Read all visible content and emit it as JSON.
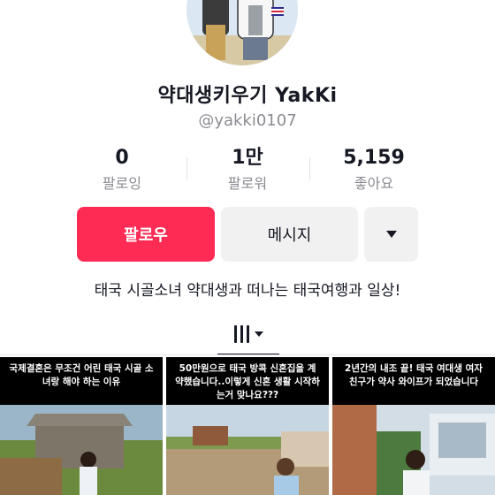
{
  "profile": {
    "display_name": "약대생키우기 YakKi",
    "username": "@yakki0107",
    "bio": "태국 시골소녀 약대생과 떠나는 태국여행과 일상!"
  },
  "stats": [
    {
      "value": "0",
      "label": "팔로잉"
    },
    {
      "value": "1만",
      "label": "팔로워"
    },
    {
      "value": "5,159",
      "label": "좋아요"
    }
  ],
  "actions": {
    "follow_label": "팔로우",
    "message_label": "메시지",
    "more_icon": "caret-down-icon"
  },
  "tabs": {
    "active_icon": "video-grid-icon",
    "dropdown_icon": "caret-down-icon"
  },
  "videos": [
    {
      "caption": "국제결혼은 무조건 어린 태국 시골 소녀랑 해야 하는 이유"
    },
    {
      "caption": "50만원으로 태국 방콕 신혼집을 계약했습니다..이렇게 신혼 생활 시작하는거 맞나요???"
    },
    {
      "caption": "2년간의 내조 끝! 태국 여대생 여자친구가 약사 와이프가 되었습니다"
    }
  ],
  "colors": {
    "accent": "#fe2c55",
    "secondary_button": "#f1f1f2",
    "muted_text": "#8a8b91"
  }
}
